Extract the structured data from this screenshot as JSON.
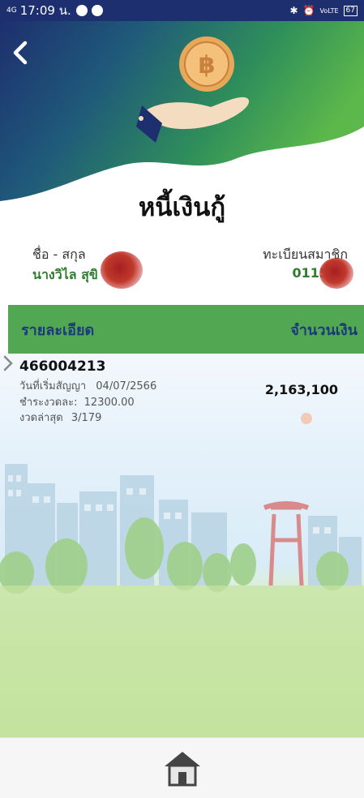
{
  "status_bar": {
    "network": "4G",
    "time": "17:09 น.",
    "lte": "VoLTE",
    "battery": "67"
  },
  "header": {
    "title": "หนี้เงินกู้",
    "coin_symbol": "฿",
    "back_icon": "chevron-left-icon"
  },
  "member": {
    "name_label": "ชื่อ - สกุล",
    "name_value": "นางวิไล สุขิ",
    "id_label": "ทะเบียนสมาชิก",
    "id_value": "0115"
  },
  "table": {
    "col_detail": "รายละเอียด",
    "col_amount": "จำนวนเงิน"
  },
  "loans": [
    {
      "number": "466004213",
      "start_label": "วันที่เริ่มสัญญา",
      "start_date": "04/07/2566",
      "installment_label": "ชำระงวดละ:",
      "installment": "12300.00",
      "last_label": "งวดล่าสุด",
      "last": "3/179",
      "amount": "2,163,100"
    }
  ],
  "bottom_nav": {
    "home_icon": "home-icon"
  },
  "colors": {
    "header_dark": "#1d2f6e",
    "header_green": "#4caf50",
    "bar_green": "#52a852",
    "name_green": "#2f7d2f",
    "label_blue": "#1b3a7a"
  }
}
